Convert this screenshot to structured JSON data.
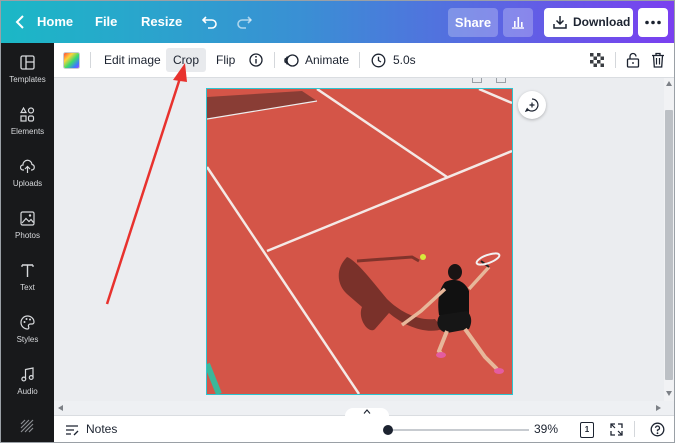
{
  "topbar": {
    "home_label": "Home",
    "file_label": "File",
    "resize_label": "Resize",
    "share_label": "Share",
    "download_label": "Download"
  },
  "sidebar": {
    "items": [
      {
        "label": "Templates",
        "icon": "templates-icon"
      },
      {
        "label": "Elements",
        "icon": "elements-icon"
      },
      {
        "label": "Uploads",
        "icon": "uploads-icon"
      },
      {
        "label": "Photos",
        "icon": "photos-icon"
      },
      {
        "label": "Text",
        "icon": "text-icon"
      },
      {
        "label": "Styles",
        "icon": "styles-icon"
      },
      {
        "label": "Audio",
        "icon": "audio-icon"
      }
    ]
  },
  "toolbar": {
    "edit_image_label": "Edit image",
    "crop_label": "Crop",
    "flip_label": "Flip",
    "animate_label": "Animate",
    "duration_label": "5.0s"
  },
  "canvas": {
    "image_subject": "tennis player on red clay court",
    "border_color": "#2ec4cf",
    "annotation_arrow_color": "#e8322e"
  },
  "bottombar": {
    "notes_label": "Notes",
    "zoom_value": "39%",
    "page_count": "1",
    "zoom_fraction": 0.39
  },
  "colors": {
    "gradient_start": "#1bb8c6",
    "gradient_end": "#7a3ff0",
    "sidebar_bg": "#18191b",
    "court": "#d9584b"
  }
}
